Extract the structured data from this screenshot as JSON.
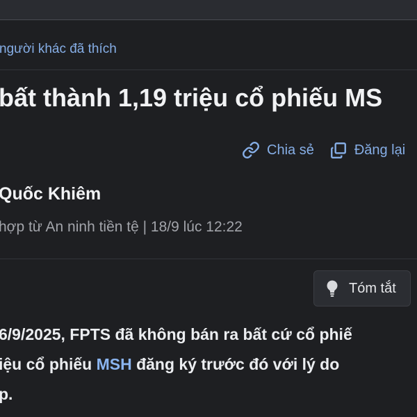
{
  "likes_text": "người khác đã thích",
  "headline": "bất thành 1,19 triệu cổ phiếu MS",
  "actions": {
    "share_label": "Chia sẻ",
    "repost_label": "Đăng lại"
  },
  "author": "Quốc Khiêm",
  "meta": "hợp từ An ninh tiền tệ | 18/9 lúc 12:22",
  "summary_button_label": "Tóm tắt",
  "body": {
    "line1": "6/9/2025, FPTS đã không bán ra bất cứ cổ phiế",
    "line2_prefix": "iệu cổ phiếu ",
    "line2_link": "MSH",
    "line2_suffix": " đăng ký trước đó với lý do",
    "line3": "p."
  },
  "colors": {
    "background": "#1e1f22",
    "link": "#86aee6",
    "text": "#e6e7ea",
    "muted": "#a2a4aa"
  },
  "icons": {
    "share": "link-icon",
    "repost": "repost-icon",
    "summary": "lightbulb-icon"
  }
}
